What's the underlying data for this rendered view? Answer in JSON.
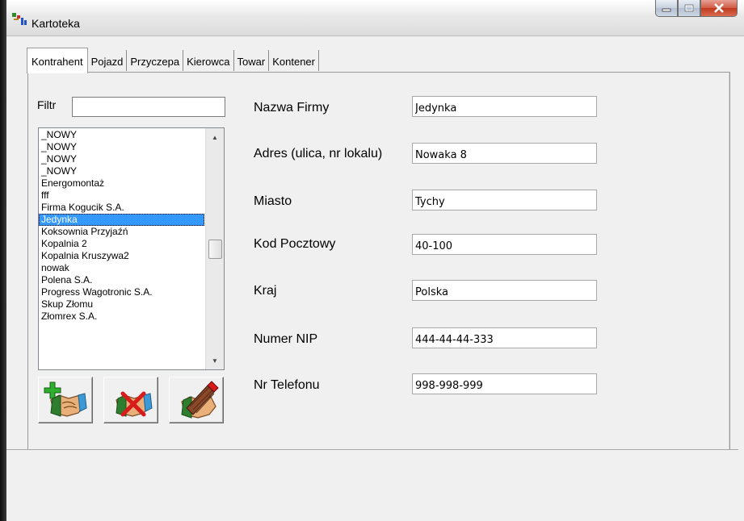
{
  "window": {
    "title": "Kartoteka"
  },
  "tabs": [
    {
      "label": "Kontrahent",
      "active": true
    },
    {
      "label": "Pojazd"
    },
    {
      "label": "Przyczepa"
    },
    {
      "label": "Kierowca"
    },
    {
      "label": "Towar"
    },
    {
      "label": "Kontener"
    }
  ],
  "filter": {
    "label": "Filtr",
    "value": ""
  },
  "list": {
    "items": [
      "_NOWY",
      "_NOWY",
      "_NOWY",
      "_NOWY",
      "Energomontaż",
      "fff",
      "Firma Kogucik S.A.",
      "Jedynka",
      "Koksownia Przyjaźń",
      "Kopalnia 2",
      "Kopalnia Kruszywa2",
      "nowak",
      "Polena S.A.",
      "Progress Wagotronic S.A.",
      "Skup Złomu",
      "Złomrex S.A."
    ],
    "selected": "Jedynka"
  },
  "icons": [
    "add-contractor-icon",
    "delete-contractor-icon",
    "edit-contractor-icon"
  ],
  "form": {
    "company_name": {
      "label": "Nazwa Firmy",
      "value": "Jedynka"
    },
    "address": {
      "label": "Adres (ulica, nr lokalu)",
      "value": "Nowaka 8"
    },
    "city": {
      "label": "Miasto",
      "value": "Tychy"
    },
    "postal_code": {
      "label": "Kod Pocztowy",
      "value": "40-100"
    },
    "country": {
      "label": "Kraj",
      "value": "Polska"
    },
    "nip": {
      "label": "Numer NIP",
      "value": "444-44-44-333"
    },
    "phone": {
      "label": "Nr Telefonu",
      "value": "998-998-999"
    }
  },
  "colors": {
    "selection": "#3399ff",
    "close_button": "#c0391f"
  }
}
